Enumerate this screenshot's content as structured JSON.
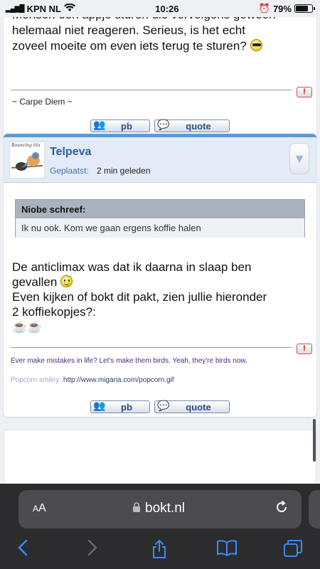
{
  "status_bar": {
    "carrier": "KPN NL",
    "time": "10:26",
    "battery": "79%",
    "battery_level": 0.79
  },
  "post1": {
    "message_lines": [
      "Mensen een appje sturen die vervolgens gewoon",
      "helemaal niet reageren. Serieus, is het echt",
      "zoveel moeite om even iets terug te sturen?"
    ],
    "signature": "~ Carpe Diem ~",
    "report_label": "!",
    "pb_label": "pb",
    "quote_label": "quote"
  },
  "post2": {
    "avatar_caption": "Bouncing tits",
    "username": "Telpeva",
    "posted_label": "Geplaatst:",
    "posted_time": "2 min geleden",
    "quote_author": "Niobe schreef:",
    "quote_text": "Ik nu ook. Kom we gaan ergens koffie halen",
    "body_line1": "De anticlimax was dat ik daarna in slaap ben",
    "body_line2": "gevallen",
    "body_line3": "Even kijken of bokt dit pakt, zien jullie hieronder",
    "body_line4": "2 koffiekopjes?:",
    "cups": "☕☕",
    "signature_line": "Ever make mistakes in life? Let's make them birds. Yeah, they're birds now.",
    "popcorn_label": "Popcorn smiley:",
    "popcorn_url": "http://www.migaria.com/popcorn.gif",
    "report_label": "!",
    "pb_label": "pb",
    "quote_label": "quote"
  },
  "browser": {
    "aa_label": "AA",
    "url": "bokt.nl"
  },
  "colors": {
    "accent": "#5b9bd5",
    "username": "#2d5fa0",
    "ios_blue": "#3a8cf7"
  }
}
